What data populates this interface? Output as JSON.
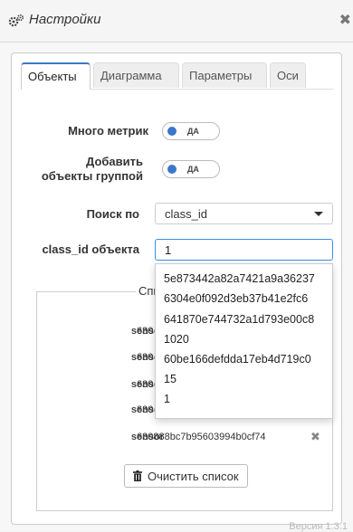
{
  "header": {
    "title": "Настройки",
    "icon": "gears-icon",
    "close_icon": "close-icon"
  },
  "tabs": [
    {
      "label": "Объекты",
      "active": true
    },
    {
      "label": "Диаграмма",
      "active": false
    },
    {
      "label": "Параметры",
      "active": false
    },
    {
      "label": "Оси",
      "active": false
    }
  ],
  "form": {
    "many_metrics": {
      "label": "Много метрик",
      "value": "ДА"
    },
    "group_add": {
      "label_line1": "Добавить",
      "label_line2": "объекты группой",
      "value": "ДА"
    },
    "search_by": {
      "label": "Поиск по",
      "value": "class_id"
    },
    "object_id": {
      "label": "class_id объекта",
      "value": "1"
    }
  },
  "list": {
    "legend": "Спи",
    "rows": [
      {
        "category": "sensor",
        "value": "630"
      },
      {
        "category": "sensor",
        "value": "630"
      },
      {
        "category": "sensor",
        "value": "630"
      },
      {
        "category": "sensor",
        "value": "630"
      },
      {
        "category": "sensor",
        "value": "630888bc7b95603994b0cf74"
      }
    ],
    "clear_label": "Очистить список"
  },
  "dropdown": {
    "items": [
      "5e873442a82a7421a9a36237",
      "6304e0f092d3eb37b41e2fc6",
      "641870e744732a1d793e00c8",
      "1020",
      "60be166defdda17eb4d719c0",
      "15",
      "1"
    ]
  },
  "footer": {
    "version": "Версия 1.3.1"
  },
  "colors": {
    "accent": "#3a78c9",
    "focus_border": "#3a8ee6"
  }
}
